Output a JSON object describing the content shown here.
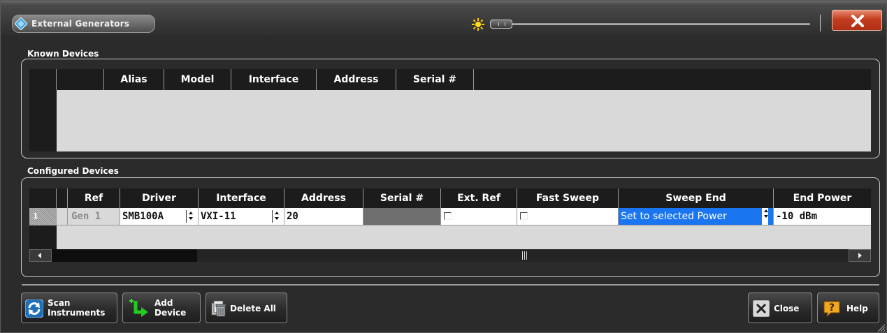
{
  "window": {
    "title": "External Generators",
    "accent_close_color": "#c43d1f"
  },
  "known_devices": {
    "group_label": "Known Devices",
    "columns": [
      "Alias",
      "Model",
      "Interface",
      "Address",
      "Serial #"
    ],
    "rows": []
  },
  "configured_devices": {
    "group_label": "Configured Devices",
    "columns": [
      "Ref",
      "Driver",
      "Interface",
      "Address",
      "Serial #",
      "Ext. Ref",
      "Fast Sweep",
      "Sweep End",
      "End Power"
    ],
    "rows": [
      {
        "row_number": "1",
        "ref": "Gen 1",
        "driver": "SMB100A",
        "interface": "VXI-11",
        "address": "20",
        "serial": "",
        "ext_ref": false,
        "fast_sweep": false,
        "sweep_end": "Set to selected Power",
        "end_power": "-10 dBm"
      }
    ]
  },
  "buttons": {
    "scan_line1": "Scan",
    "scan_line2": "Instruments",
    "add_line1": "Add",
    "add_line2": "Device",
    "delete_all": "Delete All",
    "close": "Close",
    "help": "Help"
  },
  "icons": [
    "app-icon",
    "sun-icon",
    "close-x-icon",
    "refresh-icon",
    "add-device-icon",
    "delete-icon",
    "close-icon",
    "help-icon"
  ]
}
